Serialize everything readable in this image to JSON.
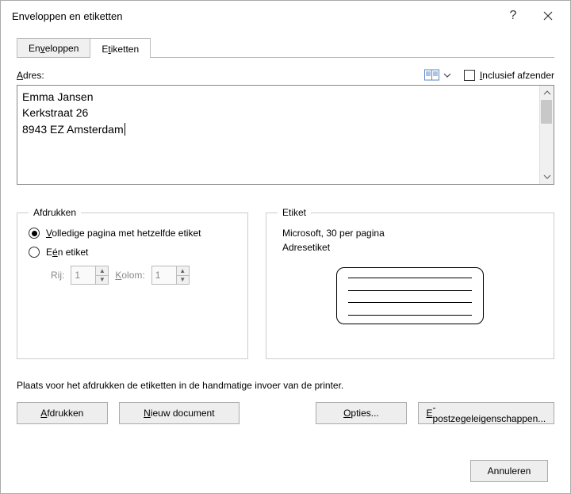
{
  "titlebar": {
    "title": "Enveloppen en etiketten"
  },
  "tabs": {
    "envelopes_pre": "En",
    "envelopes_ul": "v",
    "envelopes_post": "eloppen",
    "labels_pre": "E",
    "labels_ul": "t",
    "labels_post": "iketten"
  },
  "address": {
    "label_ul": "A",
    "label_post": "dres:",
    "line1": "Emma Jansen",
    "line2": "Kerkstraat 26",
    "line3": "8943 EZ  Amsterdam"
  },
  "include_sender": {
    "ul": "I",
    "post": "nclusief afzender"
  },
  "print_group": {
    "legend": "Afdrukken",
    "full_ul": "V",
    "full_post": "olledige pagina met hetzelfde etiket",
    "single_pre": "E",
    "single_ul": "é",
    "single_post": "n etiket",
    "row_pre": "Ri",
    "row_ul": "j",
    "row_post": ":",
    "col_ul": "K",
    "col_post": "olom:",
    "row_val": "1",
    "col_val": "1"
  },
  "label_group": {
    "legend": "Etiket",
    "line1": "Microsoft, 30 per pagina",
    "line2": "Adresetiket"
  },
  "hint": "Plaats voor het afdrukken de etiketten in de handmatige invoer van de printer.",
  "buttons": {
    "print_ul": "A",
    "print_post": "fdrukken",
    "new_ul": "N",
    "new_post": "ieuw document",
    "opt_ul": "O",
    "opt_post": "pties...",
    "epost_ul": "E",
    "epost_post": "-postzegeleigenschappen..."
  },
  "footer": {
    "cancel": "Annuleren"
  }
}
